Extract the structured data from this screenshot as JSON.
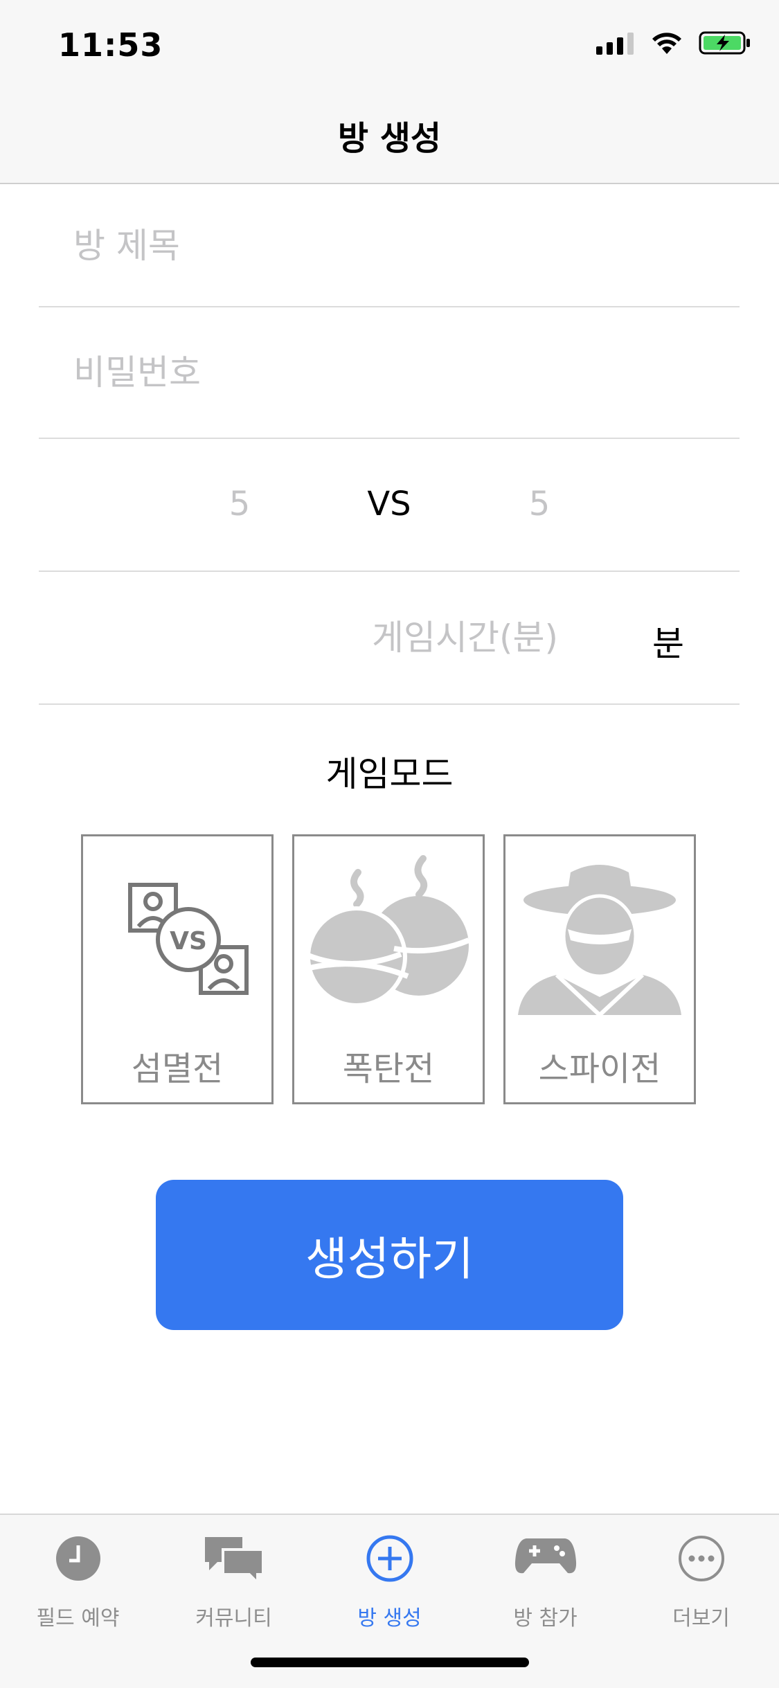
{
  "status_bar": {
    "time": "11:53"
  },
  "nav": {
    "title": "방 생성"
  },
  "form": {
    "room_title_placeholder": "방 제목",
    "password_placeholder": "비밀번호",
    "team_left": "5",
    "vs_label": "VS",
    "team_right": "5",
    "game_time_placeholder": "게임시간(분)",
    "game_time_unit": "분"
  },
  "game_mode": {
    "title": "게임모드",
    "modes": [
      {
        "label": "섬멸전",
        "icon": "vs-icon"
      },
      {
        "label": "폭탄전",
        "icon": "bomb-icon"
      },
      {
        "label": "스파이전",
        "icon": "spy-icon"
      }
    ]
  },
  "create_button_label": "생성하기",
  "tab_bar": {
    "tabs": [
      {
        "label": "필드 예약",
        "icon": "clock-icon",
        "active": false
      },
      {
        "label": "커뮤니티",
        "icon": "chat-bubbles-icon",
        "active": false
      },
      {
        "label": "방 생성",
        "icon": "plus-circle-icon",
        "active": true
      },
      {
        "label": "방 참가",
        "icon": "gamepad-icon",
        "active": false
      },
      {
        "label": "더보기",
        "icon": "more-icon",
        "active": false
      }
    ]
  },
  "colors": {
    "accent": "#3578f0",
    "placeholder": "#c4c4c6",
    "mode_gray": "#8a8a8a",
    "battery": "#4cd964"
  }
}
